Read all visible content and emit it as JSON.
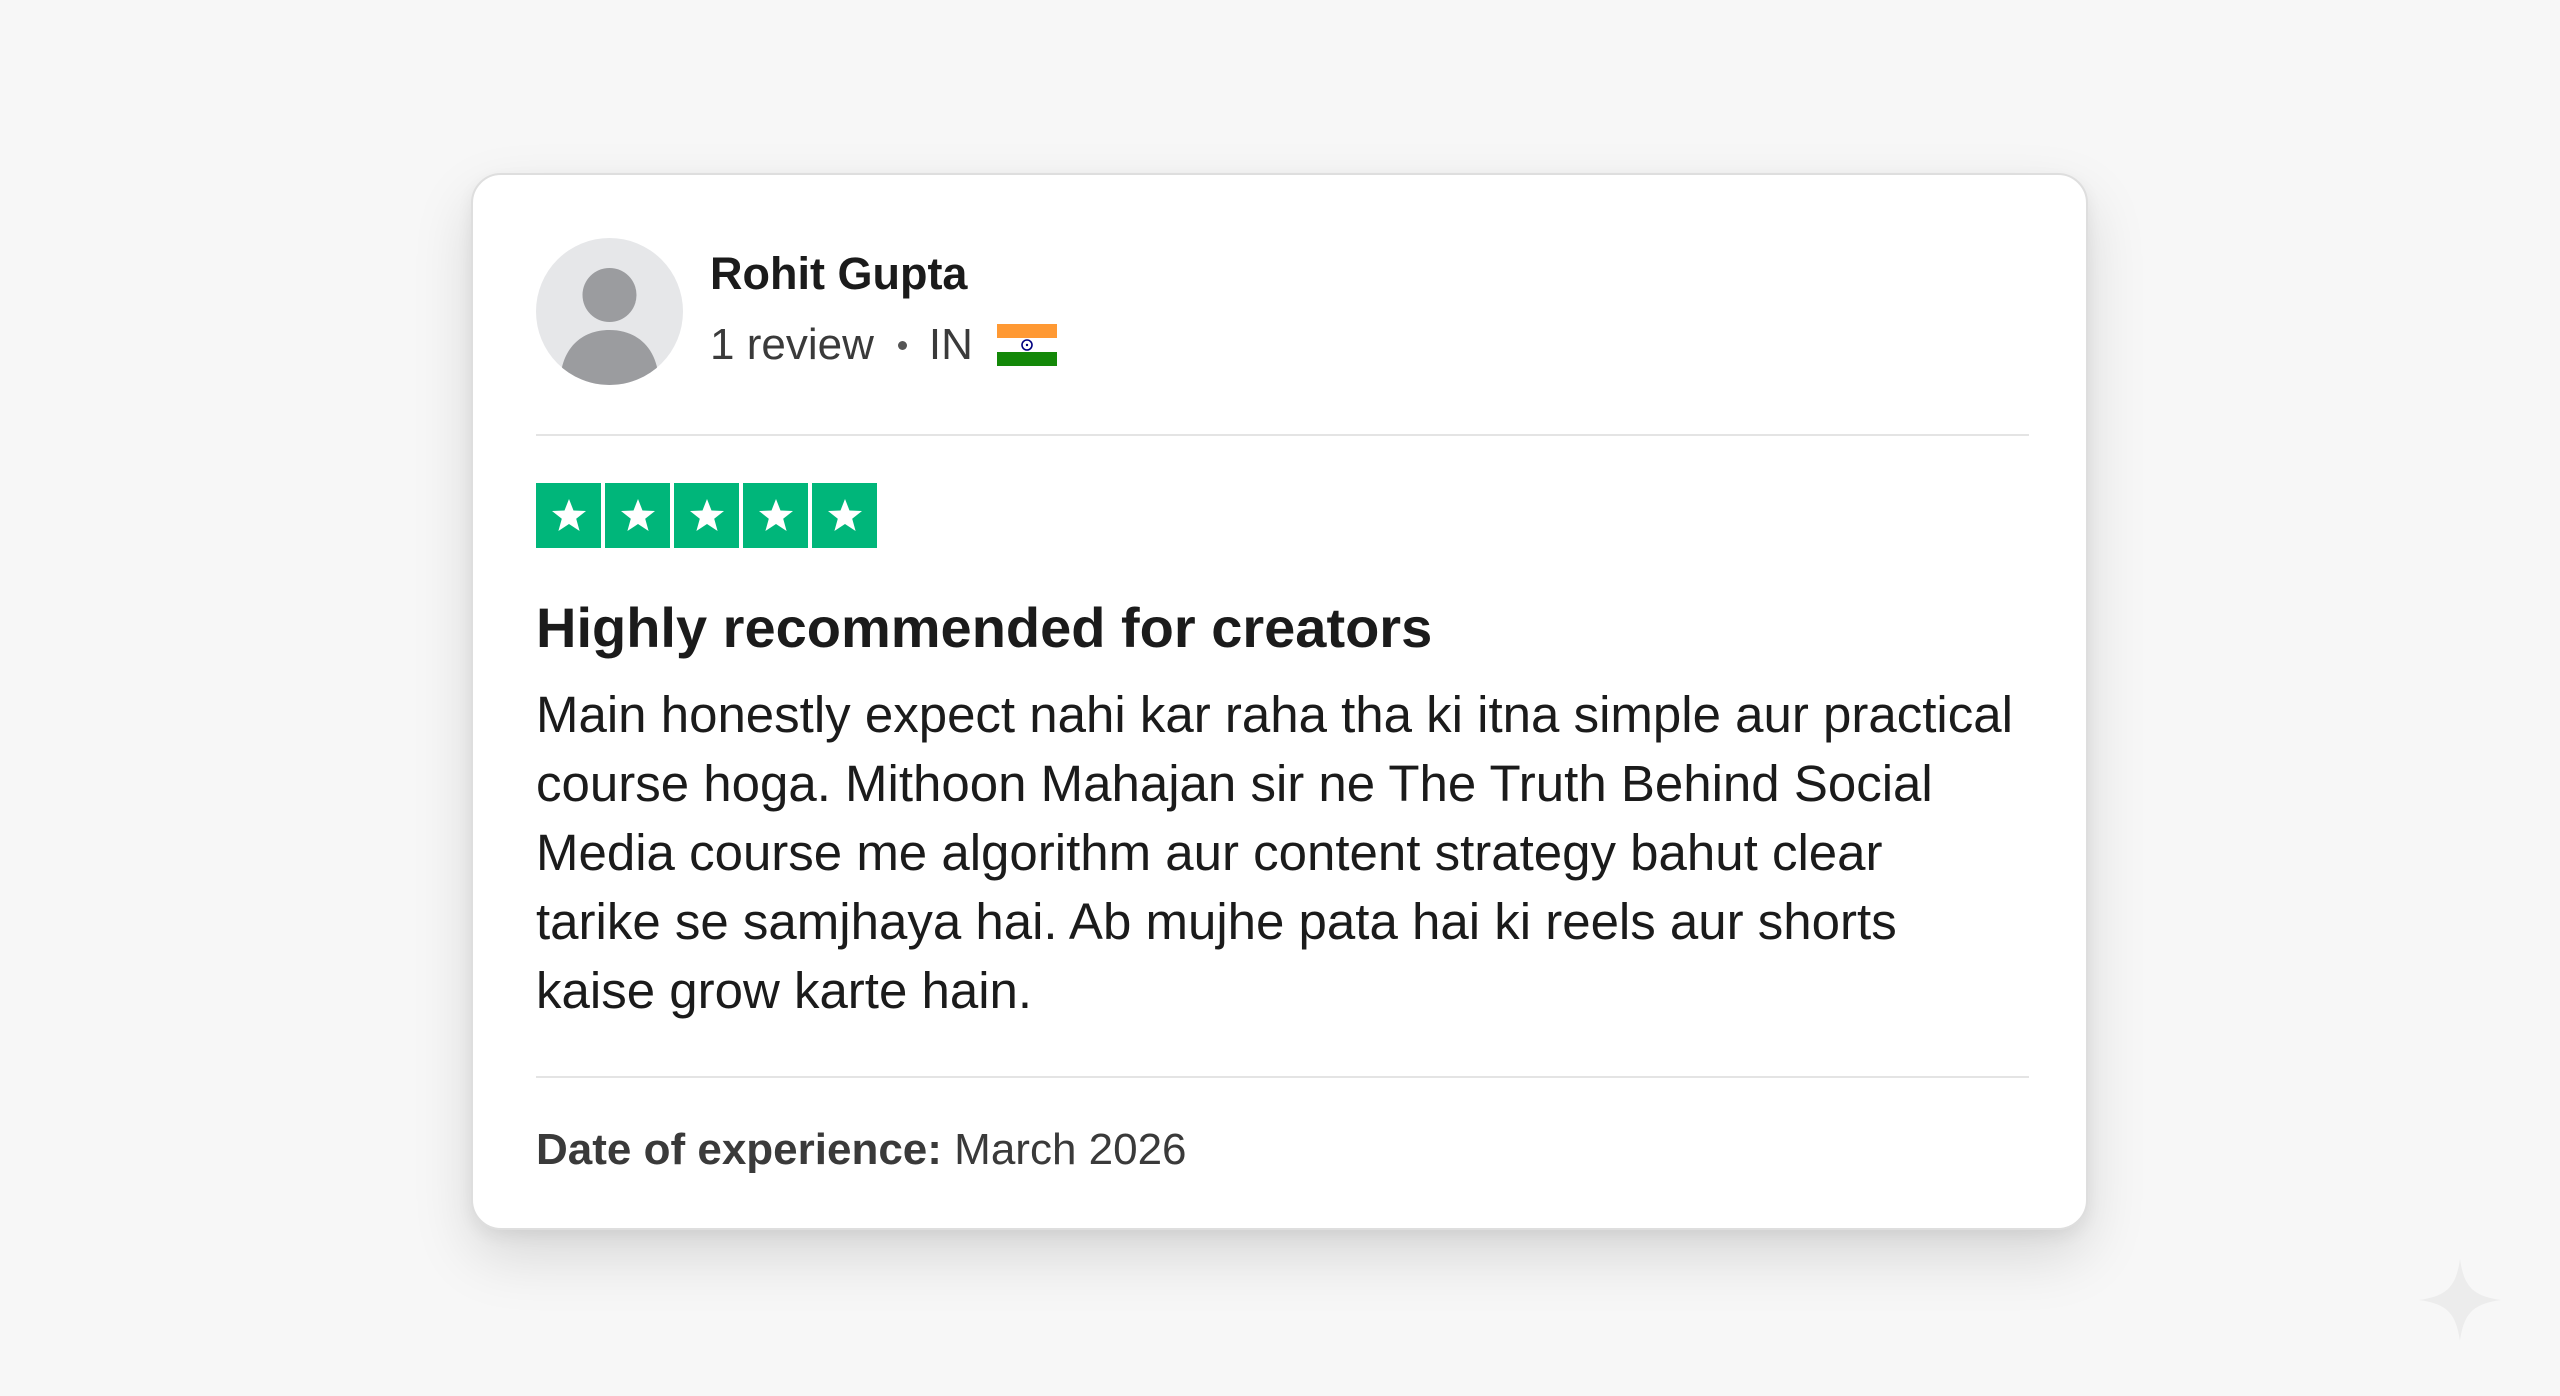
{
  "reviewer": {
    "name": "Rohit Gupta",
    "review_count": "1 review",
    "country": "IN",
    "flag_icon": "india-flag-icon",
    "avatar_icon": "default-user-avatar-icon"
  },
  "review": {
    "rating": 5,
    "max_rating": 5,
    "star_color": "#00b67a",
    "title": "Highly recommended for creators",
    "body_lines": [
      "Main honestly expect nahi kar raha tha ki itna simple aur practical",
      "course hoga. Mithoon Mahajan sir ne The Truth Behind Social",
      "Media course me algorithm aur content strategy bahut clear",
      "tarike se samjhaya hai. Ab mujhe pata hai ki reels aur shorts",
      "kaise grow karte hain."
    ]
  },
  "experience": {
    "label": "Date of experience:",
    "value": "March 2026"
  }
}
